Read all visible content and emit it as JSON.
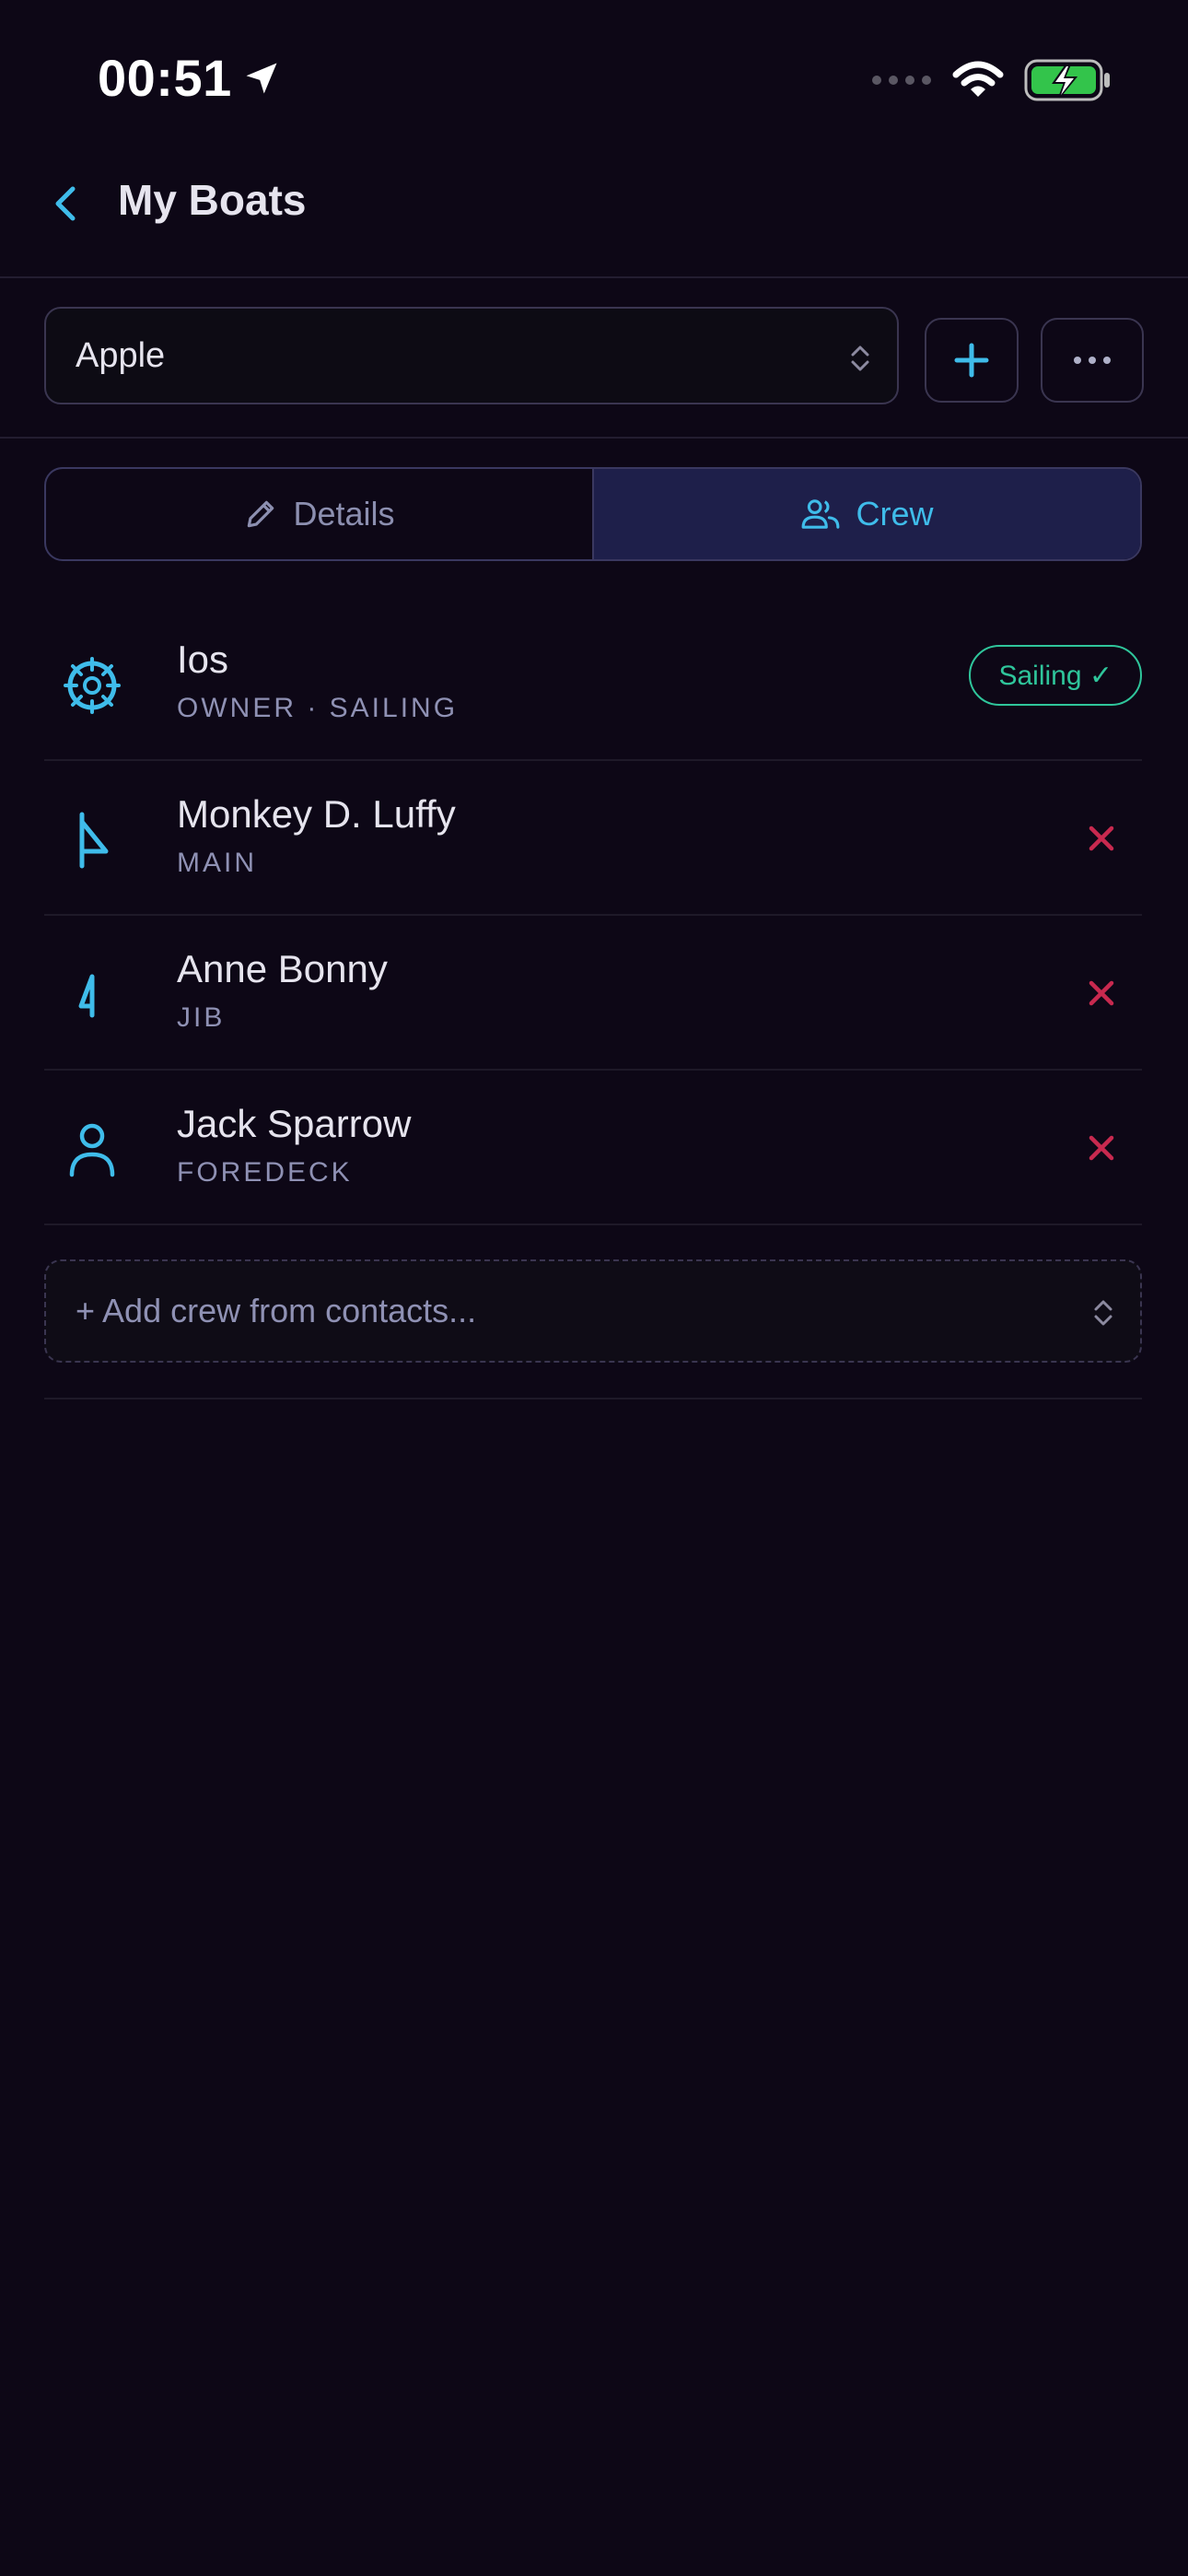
{
  "status_bar": {
    "time": "00:51"
  },
  "nav": {
    "title": "My Boats"
  },
  "boat_selector": {
    "value": "Apple"
  },
  "tabs": [
    {
      "label": "Details",
      "icon": "pencil-icon",
      "active": false
    },
    {
      "label": "Crew",
      "icon": "users-icon",
      "active": true
    }
  ],
  "crew": [
    {
      "name": "Ios",
      "role": "OWNER · SAILING",
      "icon": "helm-icon",
      "badge": "Sailing ✓"
    },
    {
      "name": "Monkey D. Luffy",
      "role": "MAIN",
      "icon": "mainsail-icon"
    },
    {
      "name": "Anne Bonny",
      "role": "JIB",
      "icon": "jib-icon"
    },
    {
      "name": "Jack Sparrow",
      "role": "FOREDECK",
      "icon": "person-icon"
    }
  ],
  "add_crew": {
    "placeholder": "+ Add crew from contacts..."
  },
  "colors": {
    "background": "#0d0716",
    "accent": "#3fbcea",
    "active_tab": "#1e1f4a",
    "danger": "#c8294f",
    "success": "#2fc59b"
  }
}
